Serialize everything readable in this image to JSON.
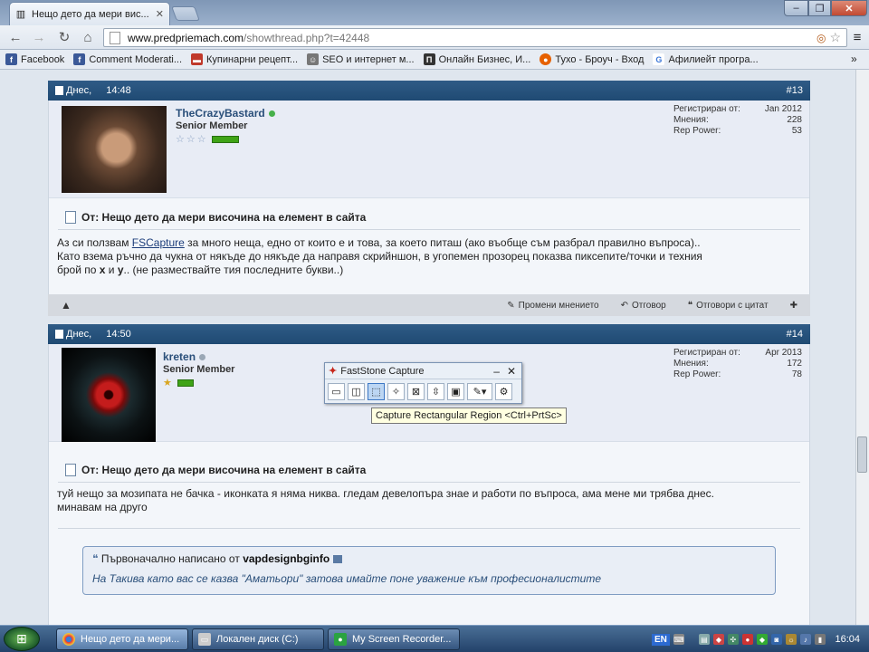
{
  "browser": {
    "tab_title": "Нещо дето да мери вис...",
    "tab_close": "✕",
    "url_host": "www.predpriemach.com",
    "url_path": "/showthread.php?t=42448",
    "bookmarks": [
      {
        "label": "Facebook",
        "icon": "facebook-icon",
        "color": "#3b5998"
      },
      {
        "label": "Comment Moderati...",
        "icon": "facebook-icon",
        "color": "#3b5998"
      },
      {
        "label": "Купинарни рецепт...",
        "icon": "recipe-icon",
        "color": "#c0392b"
      },
      {
        "label": "SEO и интернет м...",
        "icon": "seo-icon",
        "color": "#555"
      },
      {
        "label": "Онлайн Бизнес, И...",
        "icon": "business-icon",
        "color": "#333"
      },
      {
        "label": "Тухо - Броуч - Вход",
        "icon": "firefox-icon",
        "color": "#e66000"
      },
      {
        "label": "Афилиейт програ...",
        "icon": "google-icon",
        "color": "#3c78d8"
      }
    ],
    "more": "»"
  },
  "posts": [
    {
      "date": "Днес,",
      "time": "14:48",
      "number": "#13",
      "username": "TheCrazyBastard",
      "online_color": "#46b04a",
      "user_title": "Senior Member",
      "star_count": 3,
      "stars": [
        "☆",
        "☆",
        "☆"
      ],
      "stats": [
        {
          "label": "Регистриран от:",
          "value": "Jan 2012"
        },
        {
          "label": "Мнения:",
          "value": "228"
        },
        {
          "label": "Rep Power:",
          "value": "53"
        }
      ],
      "title": "От: Нещо дето да мери височина на елемент в сайта",
      "text_before_link": "Аз си ползвам ",
      "link": "FSCapture",
      "text_after_link": " за много неща, едно от които е и това, за което питаш (ако въобще съм разбрал правилно въпроса)..",
      "text_line2": "Като взема ръчно да чукна от някъде до някъде да направя скрийншон, в угопемен прозорец показва пиксепите/точки и техния",
      "text_line3_a": "брой по ",
      "x": "x",
      "and": " и ",
      "y": "y",
      "text_line3_b": ".. (не размествайте тия последните букви..)",
      "footer": {
        "edit": "Промени мнението",
        "reply": "Отговор",
        "quote": "Отговори с цитат"
      }
    },
    {
      "date": "Днес,",
      "time": "14:50",
      "number": "#14",
      "username": "kreten",
      "online_color": "#9aa7b5",
      "user_title": "Senior Member",
      "star_count": 1,
      "stars": [
        "★"
      ],
      "stats": [
        {
          "label": "Регистриран от:",
          "value": "Apr 2013"
        },
        {
          "label": "Мнения:",
          "value": "172"
        },
        {
          "label": "Rep Power:",
          "value": "78"
        }
      ],
      "title": "От: Нещо дето да мери височина на елемент в сайта",
      "text_line1": "туй нещо за мозипата не бачка - иконката я няма никва. гледам девелопъра знае и работи по въпроса, ама мене ми трябва днес.",
      "text_line2": "минавам на друго",
      "quote": {
        "prefix": "Първоначално написано от",
        "author": "vapdesignbginfo",
        "text": "На Такива като вас се казва \"Аматьори\" затова имайте поне уважение към професионалистите"
      }
    }
  ],
  "faststone": {
    "title": "FastStone Capture",
    "minimize": "–",
    "close": "✕",
    "tooltip": "Capture Rectangular Region <Ctrl+PrtSc>"
  },
  "taskbar": {
    "tasks": [
      {
        "label": "Нещо дето да мери...",
        "icon": "chrome-icon",
        "active": true
      },
      {
        "label": "Локален диск (C:)",
        "icon": "folder-icon",
        "active": false
      },
      {
        "label": "My Screen Recorder...",
        "icon": "recorder-icon",
        "active": false
      }
    ],
    "lang": "EN",
    "clock": "16:04"
  }
}
